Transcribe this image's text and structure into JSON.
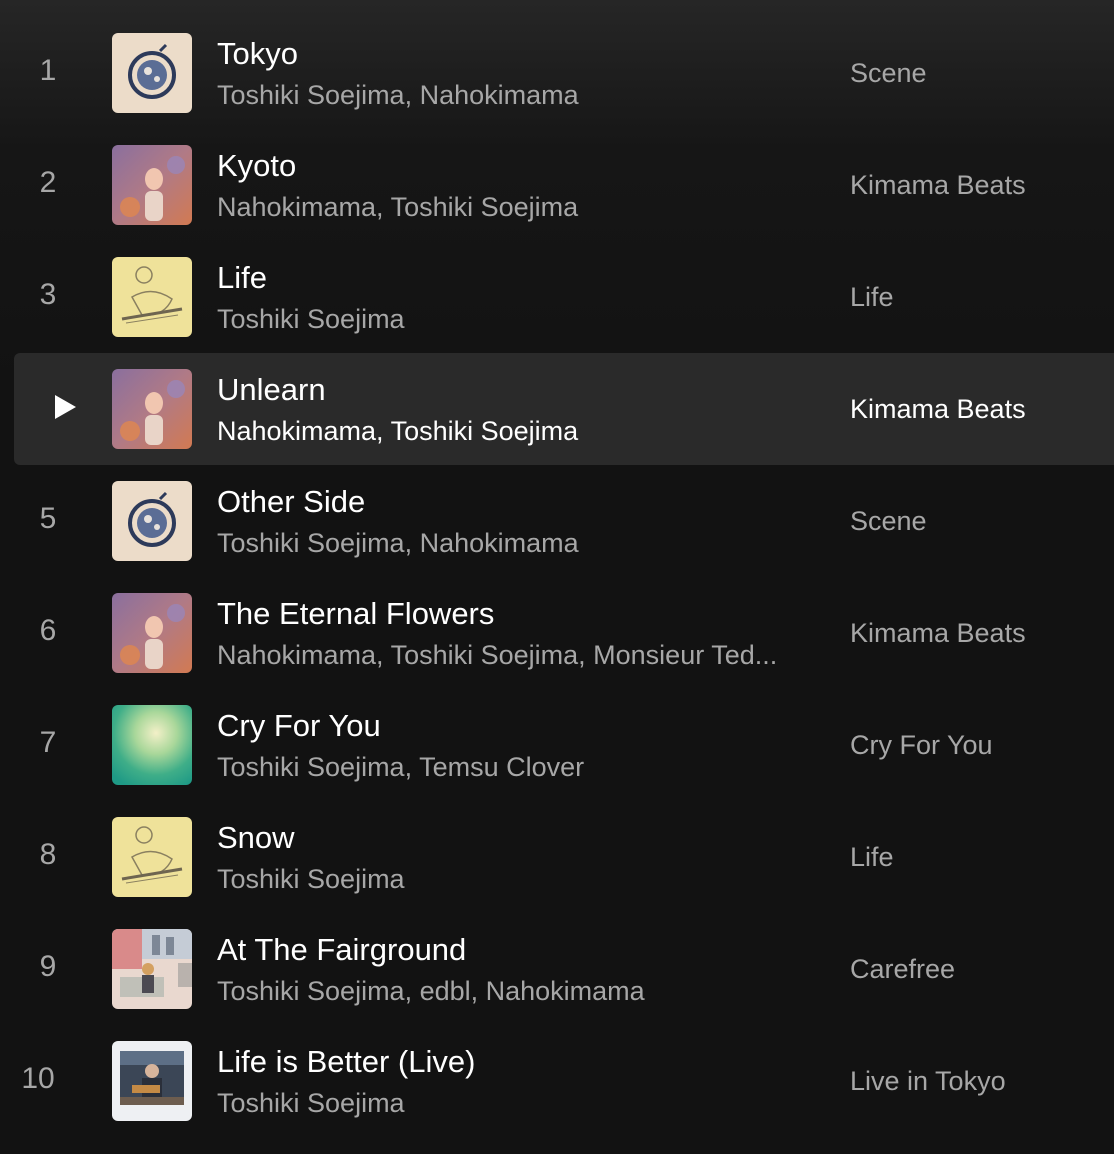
{
  "tracks": [
    {
      "number": "1",
      "title": "Tokyo",
      "artists": "Toshiki Soejima, Nahokimama",
      "album": "Scene",
      "cover": "scene-cover-icon",
      "playing": false
    },
    {
      "number": "2",
      "title": "Kyoto",
      "artists": "Nahokimama, Toshiki Soejima",
      "album": "Kimama Beats",
      "cover": "kimama-beats-cover-icon",
      "playing": false
    },
    {
      "number": "3",
      "title": "Life",
      "artists": "Toshiki Soejima",
      "album": "Life",
      "cover": "life-cover-icon",
      "playing": false
    },
    {
      "number": "4",
      "title": "Unlearn",
      "artists": "Nahokimama, Toshiki Soejima",
      "album": "Kimama Beats",
      "cover": "kimama-beats-cover-icon",
      "playing": true
    },
    {
      "number": "5",
      "title": "Other Side",
      "artists": "Toshiki Soejima, Nahokimama",
      "album": "Scene",
      "cover": "scene-cover-icon",
      "playing": false
    },
    {
      "number": "6",
      "title": "The Eternal Flowers",
      "artists": "Nahokimama, Toshiki Soejima, Monsieur Ted...",
      "album": "Kimama Beats",
      "cover": "kimama-beats-cover-icon",
      "playing": false
    },
    {
      "number": "7",
      "title": "Cry For You",
      "artists": "Toshiki Soejima, Temsu Clover",
      "album": "Cry For You",
      "cover": "cry-for-you-cover-icon",
      "playing": false
    },
    {
      "number": "8",
      "title": "Snow",
      "artists": "Toshiki Soejima",
      "album": "Life",
      "cover": "life-cover-icon",
      "playing": false
    },
    {
      "number": "9",
      "title": "At The Fairground",
      "artists": "Toshiki Soejima, edbl, Nahokimama",
      "album": "Carefree",
      "cover": "carefree-cover-icon",
      "playing": false
    },
    {
      "number": "10",
      "title": "Life is Better (Live)",
      "artists": "Toshiki Soejima",
      "album": "Live in Tokyo",
      "cover": "live-in-tokyo-cover-icon",
      "playing": false
    }
  ],
  "colors": {
    "background": "#121212",
    "active_row": "#2a2a2a",
    "primary_text": "#ffffff",
    "secondary_text": "#a7a7a7"
  }
}
